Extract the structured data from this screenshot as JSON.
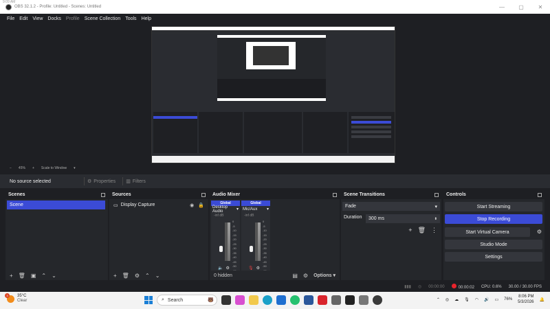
{
  "window": {
    "title": "OBS 32.1.2 - Profile: Untitled - Scenes: Untitled",
    "corner_text": "9:09 AM",
    "minimize": "—",
    "maximize": "▢",
    "close": "✕"
  },
  "menu": [
    "File",
    "Edit",
    "View",
    "Docks",
    "Profile",
    "Scene Collection",
    "Tools",
    "Help"
  ],
  "preview_status": {
    "zoom": "45%",
    "scale_mode": "Scale to Window"
  },
  "context_bar": {
    "no_source": "No source selected",
    "properties": "Properties",
    "filters": "Filters"
  },
  "scenes": {
    "title": "Scenes",
    "items": [
      "Scene"
    ]
  },
  "sources": {
    "title": "Sources",
    "items": [
      "Display Capture"
    ]
  },
  "mixer": {
    "title": "Audio Mixer",
    "channels": [
      {
        "badge": "Global",
        "name": "Desktop Audio",
        "db": "-inf dB",
        "level": 0
      },
      {
        "badge": "Global",
        "name": "Mic/Aux",
        "db": "-inf dB",
        "level": 0
      }
    ],
    "scale": [
      "0",
      "-5",
      "-10",
      "-15",
      "-20",
      "-25",
      "-30",
      "-35",
      "-40",
      "-45",
      "-50",
      "-55",
      "-60"
    ],
    "hidden": "0 hidden",
    "options": "Options"
  },
  "transitions": {
    "title": "Scene Transitions",
    "type": "Fade",
    "duration_label": "Duration",
    "duration_value": "300 ms"
  },
  "controls": {
    "title": "Controls",
    "start_streaming": "Start Streaming",
    "stop_recording": "Stop Recording",
    "start_virtual_camera": "Start Virtual Camera",
    "studio_mode": "Studio Mode",
    "settings": "Settings"
  },
  "statusbar": {
    "stream_time": "00:00:00",
    "rec_time": "00:00:02",
    "cpu": "CPU: 0.6%",
    "fps": "30.00 / 30.00 FPS"
  },
  "taskbar": {
    "temp": "35°C",
    "weather": "Clear",
    "weather_badge": "3",
    "search": "Search",
    "battery": "76%",
    "time": "8:06 PM",
    "date": "5/3/2026"
  },
  "colors": {
    "accent": "#3b4bd6",
    "rec": "#e8232b",
    "bg": "#1e1f23",
    "panel": "#25272b"
  }
}
